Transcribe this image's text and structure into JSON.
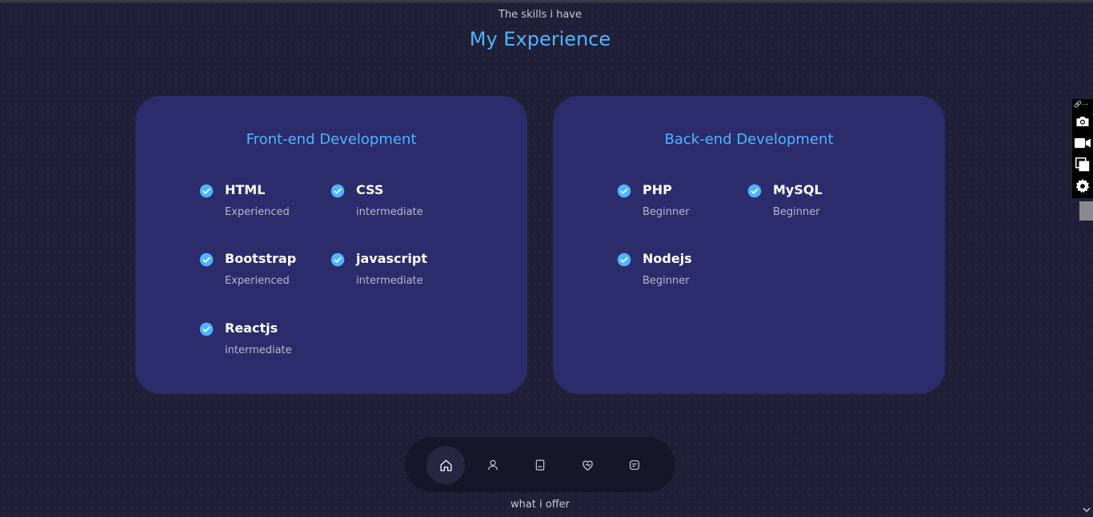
{
  "header": {
    "subtitle": "The skills i have",
    "title": "My Experience"
  },
  "cards": [
    {
      "title": "Front-end Development",
      "skills": [
        {
          "name": "HTML",
          "level": "Experienced"
        },
        {
          "name": "CSS",
          "level": "intermediate"
        },
        {
          "name": "Bootstrap",
          "level": "Experienced"
        },
        {
          "name": "javascript",
          "level": "intermediate"
        },
        {
          "name": "Reactjs",
          "level": "intermediate"
        }
      ]
    },
    {
      "title": "Back-end Development",
      "skills": [
        {
          "name": "PHP",
          "level": "Beginner"
        },
        {
          "name": "MySQL",
          "level": "Beginner"
        },
        {
          "name": "Nodejs",
          "level": "Beginner"
        }
      ]
    }
  ],
  "nav": {
    "items": [
      {
        "icon": "home-icon",
        "active": true
      },
      {
        "icon": "user-icon",
        "active": false
      },
      {
        "icon": "book-icon",
        "active": false
      },
      {
        "icon": "heart-icon",
        "active": false
      },
      {
        "icon": "message-icon",
        "active": false
      }
    ]
  },
  "footer": {
    "next_section": "what i offer"
  },
  "side_toolbar": {
    "tools": [
      "link-icon",
      "camera-icon",
      "video-icon",
      "window-icon",
      "gear-icon"
    ]
  },
  "colors": {
    "background": "#1f1f38",
    "card": "#2c2c6c",
    "accent": "#4db5ff",
    "nav_bg": "#16162a"
  }
}
